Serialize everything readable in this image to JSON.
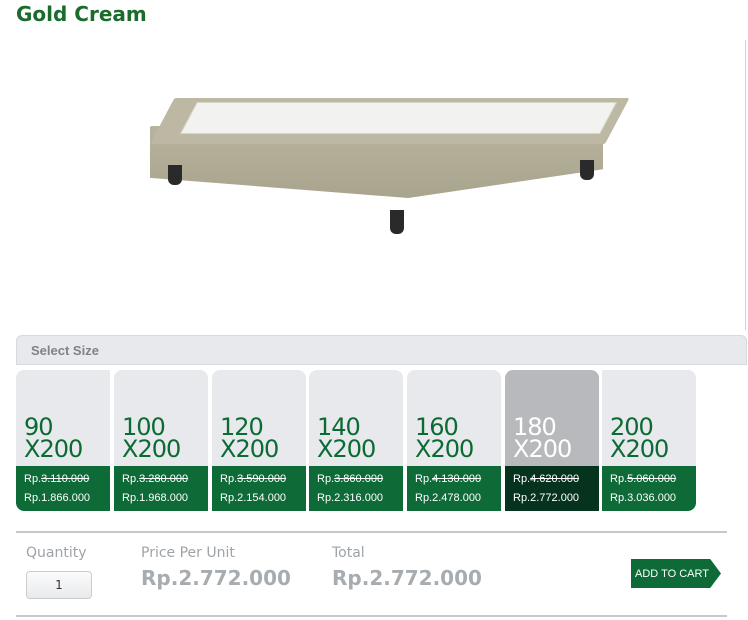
{
  "product": {
    "title": "Gold Cream"
  },
  "size_selector": {
    "label": "Select Size",
    "selected_index": 5,
    "sizes": [
      {
        "width": "90",
        "length": "X200",
        "old_price": "Rp.3.110.000",
        "new_price": "Rp.1.866.000"
      },
      {
        "width": "100",
        "length": "X200",
        "old_price": "Rp.3.280.000",
        "new_price": "Rp.1.968.000"
      },
      {
        "width": "120",
        "length": "X200",
        "old_price": "Rp.3.590.000",
        "new_price": "Rp.2.154.000"
      },
      {
        "width": "140",
        "length": "X200",
        "old_price": "Rp.3.860.000",
        "new_price": "Rp.2.316.000"
      },
      {
        "width": "160",
        "length": "X200",
        "old_price": "Rp.4.130.000",
        "new_price": "Rp.2.478.000"
      },
      {
        "width": "180",
        "length": "X200",
        "old_price": "Rp.4.620.000",
        "new_price": "Rp.2.772.000"
      },
      {
        "width": "200",
        "length": "X200",
        "old_price": "Rp.5.060.000",
        "new_price": "Rp.3.036.000"
      }
    ]
  },
  "order": {
    "quantity_label": "Quantity",
    "quantity_value": "1",
    "price_per_unit_label": "Price Per Unit",
    "price_per_unit_value": "Rp.2.772.000",
    "total_label": "Total",
    "total_value": "Rp.2.772.000",
    "add_to_cart_label": "ADD TO CART"
  },
  "colors": {
    "brand_green": "#0e6b38",
    "selected_card": "#b7b9bc",
    "selected_price": "#06331d"
  }
}
